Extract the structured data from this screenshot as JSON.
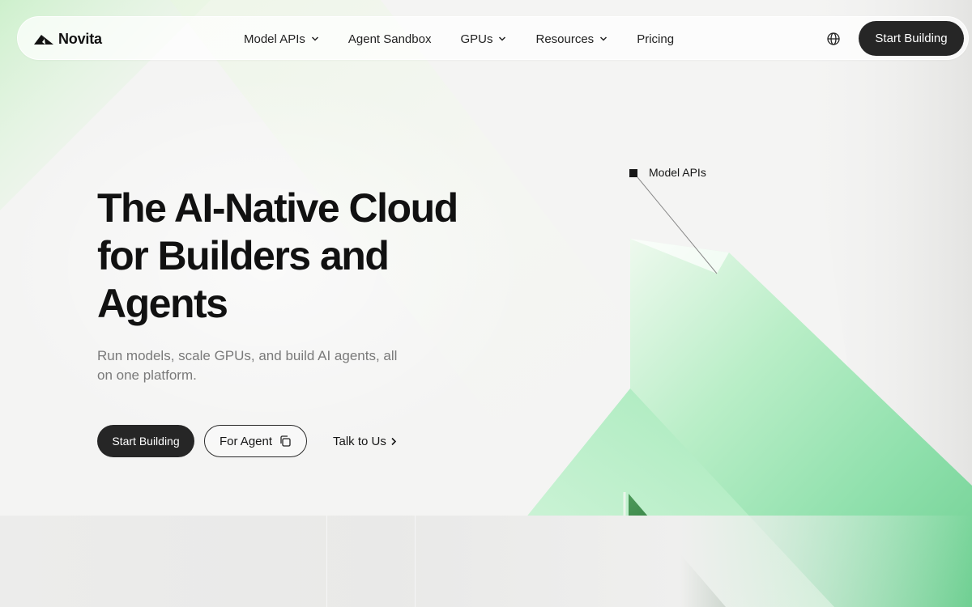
{
  "colors": {
    "page_bg": "#f4f4f3",
    "dark_button": "#262626",
    "accent_green": "#7fe0a2",
    "text_primary": "#111111",
    "text_secondary": "#7a7a7a"
  },
  "nav": {
    "brand": "Novita",
    "logo_icon": "novita-logo-icon",
    "items": [
      {
        "label": "Model APIs",
        "has_dropdown": true
      },
      {
        "label": "Agent Sandbox",
        "has_dropdown": false
      },
      {
        "label": "GPUs",
        "has_dropdown": true
      },
      {
        "label": "Resources",
        "has_dropdown": true
      },
      {
        "label": "Pricing",
        "has_dropdown": false
      }
    ],
    "language_icon": "globe-icon",
    "cta": "Start Building"
  },
  "hero": {
    "title_lines": [
      "The AI-Native Cloud",
      "for Builders and",
      "Agents"
    ],
    "subtitle_lines": [
      "Run models, scale GPUs, and build AI agents, all",
      "on one platform."
    ],
    "primary_button": "Start Building",
    "secondary_button": "For Agent",
    "secondary_button_icon": "copy-icon",
    "link_button": "Talk to Us",
    "link_button_icon": "chevron-right-icon"
  },
  "annotation": {
    "label": "Model APIs"
  }
}
